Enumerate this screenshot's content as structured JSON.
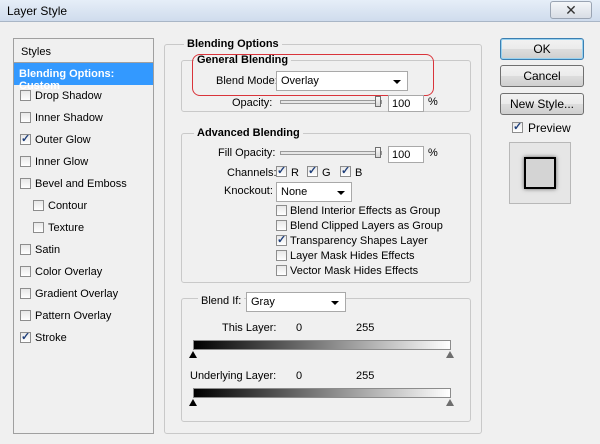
{
  "window": {
    "title": "Layer Style",
    "close_glyph": "✕"
  },
  "styles_list": {
    "header": "Styles",
    "items": [
      {
        "label": "Blending Options: Custom",
        "selected": true,
        "has_checkbox": false,
        "checked": false
      },
      {
        "label": "Drop Shadow",
        "checked": false
      },
      {
        "label": "Inner Shadow",
        "checked": false
      },
      {
        "label": "Outer Glow",
        "checked": true
      },
      {
        "label": "Inner Glow",
        "checked": false
      },
      {
        "label": "Bevel and Emboss",
        "checked": false
      },
      {
        "label": "Contour",
        "checked": false,
        "indent": true
      },
      {
        "label": "Texture",
        "checked": false,
        "indent": true
      },
      {
        "label": "Satin",
        "checked": false
      },
      {
        "label": "Color Overlay",
        "checked": false
      },
      {
        "label": "Gradient Overlay",
        "checked": false
      },
      {
        "label": "Pattern Overlay",
        "checked": false
      },
      {
        "label": "Stroke",
        "checked": true
      }
    ]
  },
  "blending_options": {
    "title": "Blending Options",
    "general": {
      "title": "General Blending",
      "blend_mode_label": "Blend Mode:",
      "blend_mode_value": "Overlay",
      "opacity_label": "Opacity:",
      "opacity_value": "100",
      "percent": "%"
    },
    "advanced": {
      "title": "Advanced Blending",
      "fill_opacity_label": "Fill Opacity:",
      "fill_opacity_value": "100",
      "percent": "%",
      "channels_label": "Channels:",
      "channels": [
        {
          "label": "R",
          "checked": true
        },
        {
          "label": "G",
          "checked": true
        },
        {
          "label": "B",
          "checked": true
        }
      ],
      "knockout_label": "Knockout:",
      "knockout_value": "None",
      "options": [
        {
          "label": "Blend Interior Effects as Group",
          "checked": false
        },
        {
          "label": "Blend Clipped Layers as Group",
          "checked": false
        },
        {
          "label": "Transparency Shapes Layer",
          "checked": true
        },
        {
          "label": "Layer Mask Hides Effects",
          "checked": false
        },
        {
          "label": "Vector Mask Hides Effects",
          "checked": false
        }
      ]
    },
    "blend_if": {
      "label": "Blend If:",
      "value": "Gray",
      "this_layer_label": "This Layer:",
      "this_layer_min": "0",
      "this_layer_max": "255",
      "underlying_label": "Underlying Layer:",
      "underlying_min": "0",
      "underlying_max": "255"
    }
  },
  "buttons": {
    "ok": "OK",
    "cancel": "Cancel",
    "new_style": "New Style..."
  },
  "preview": {
    "label": "Preview",
    "checked": true
  },
  "colors": {
    "selection": "#3399ff",
    "highlight_ring": "#d9343b",
    "default_button_border": "#3c7fb1"
  }
}
